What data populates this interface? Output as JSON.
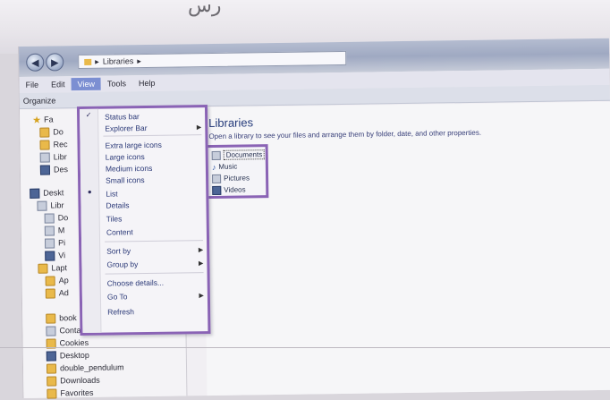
{
  "window": {
    "breadcrumb": "Libraries",
    "handwriting": "رس"
  },
  "menubar": [
    "File",
    "Edit",
    "View",
    "Tools",
    "Help"
  ],
  "toolbar": {
    "organize_label": "Organize"
  },
  "nav_pane": {
    "truncated": [
      "Fa",
      "Do",
      "Rec",
      "Libr",
      "Des",
      "Deskt",
      "Libr",
      "Do",
      "M",
      "Pi",
      "Vi",
      "Lapt",
      "Ap",
      "Ad"
    ],
    "items": [
      "book",
      "Contacts",
      "Cookies",
      "Desktop",
      "double_pendulum",
      "Downloads",
      "Favorites"
    ]
  },
  "view_menu": {
    "items": [
      {
        "label": "Status bar",
        "mark": "check"
      },
      {
        "label": "Explorer Bar",
        "submenu": true
      },
      {
        "label": "Extra large icons"
      },
      {
        "label": "Large icons"
      },
      {
        "label": "Medium icons"
      },
      {
        "label": "Small icons"
      },
      {
        "label": "List",
        "mark": "dot"
      },
      {
        "label": "Details"
      },
      {
        "label": "Tiles"
      },
      {
        "label": "Content"
      },
      {
        "label": "Sort by",
        "submenu": true
      },
      {
        "label": "Group by",
        "submenu": true
      },
      {
        "label": "Choose details..."
      },
      {
        "label": "Go To",
        "submenu": true
      },
      {
        "label": "Refresh"
      }
    ]
  },
  "content": {
    "title": "Libraries",
    "subtitle": "Open a library to see your files and arrange them by folder, date, and other properties.",
    "libraries": [
      "Documents",
      "Music",
      "Pictures",
      "Videos"
    ]
  },
  "colors": {
    "highlight": "#8a63b5",
    "menu_active": "#7c8fd2"
  }
}
